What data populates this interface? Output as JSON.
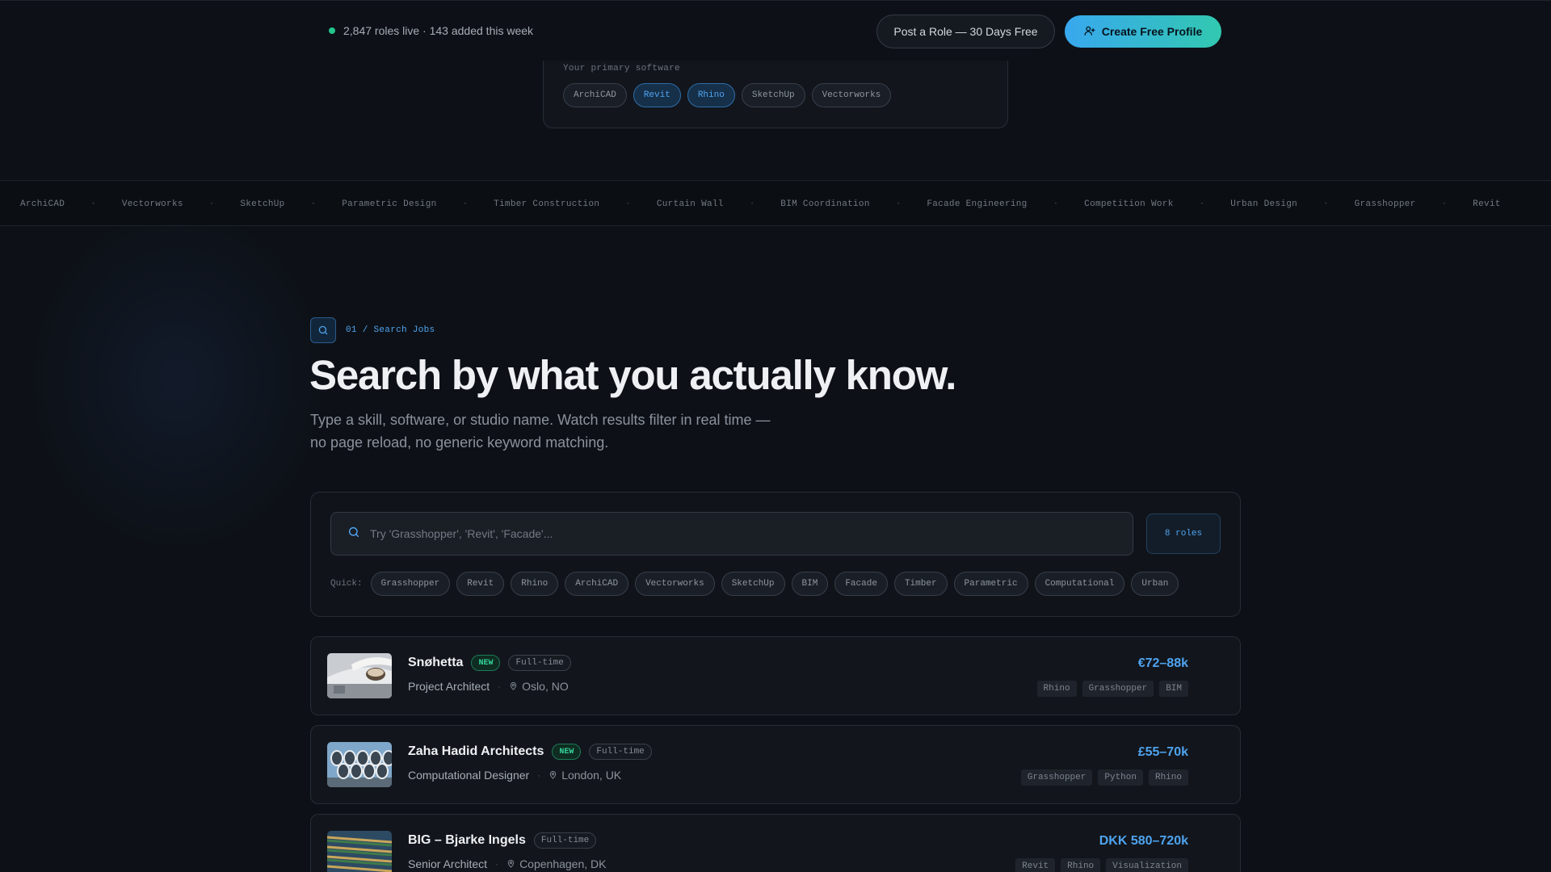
{
  "topbar": {
    "status": "2,847 roles live · 143 added this week",
    "post_role_label": "Post a Role — 30 Days Free",
    "create_profile_label": "Create Free Profile"
  },
  "software_picker": {
    "label": "Your primary software",
    "options": [
      {
        "label": "ArchiCAD",
        "selected": false
      },
      {
        "label": "Revit",
        "selected": true
      },
      {
        "label": "Rhino",
        "selected": true
      },
      {
        "label": "SketchUp",
        "selected": false
      },
      {
        "label": "Vectorworks",
        "selected": false
      }
    ]
  },
  "ticker": [
    "ArchiCAD",
    "Vectorworks",
    "SketchUp",
    "Parametric Design",
    "Timber Construction",
    "Curtain Wall",
    "BIM Coordination",
    "Facade Engineering",
    "Competition Work",
    "Urban Design",
    "Grasshopper",
    "Revit"
  ],
  "ticker_separator": "·",
  "section": {
    "eyebrow": "01 / Search Jobs",
    "title": "Search by what you actually know.",
    "subtitle_line1": "Type a skill, software, or studio name. Watch results filter in real time —",
    "subtitle_line2": "no page reload, no generic keyword matching."
  },
  "search": {
    "placeholder": "Try 'Grasshopper', 'Revit', 'Facade'...",
    "value": "",
    "count_label": "8 roles",
    "quick_label": "Quick:",
    "quick_filters": [
      "Grasshopper",
      "Revit",
      "Rhino",
      "ArchiCAD",
      "Vectorworks",
      "SketchUp",
      "BIM",
      "Facade",
      "Timber",
      "Parametric",
      "Computational",
      "Urban"
    ]
  },
  "jobs": [
    {
      "studio": "Snøhetta",
      "is_new": true,
      "new_label": "NEW",
      "type": "Full-time",
      "role": "Project Architect",
      "location": "Oslo, NO",
      "salary": "€72–88k",
      "skills": [
        "Rhino",
        "Grasshopper",
        "BIM"
      ]
    },
    {
      "studio": "Zaha Hadid Architects",
      "is_new": true,
      "new_label": "NEW",
      "type": "Full-time",
      "role": "Computational Designer",
      "location": "London, UK",
      "salary": "£55–70k",
      "skills": [
        "Grasshopper",
        "Python",
        "Rhino"
      ]
    },
    {
      "studio": "BIG – Bjarke Ingels",
      "is_new": false,
      "new_label": "",
      "type": "Full-time",
      "role": "Senior Architect",
      "location": "Copenhagen, DK",
      "salary": "DKK 580–720k",
      "skills": [
        "Revit",
        "Rhino",
        "Visualization"
      ]
    }
  ],
  "colors": {
    "background": "#0d1117",
    "accent_blue": "#4fa3ef",
    "accent_green": "#22c58b",
    "gradient_start": "#38a8ef",
    "gradient_end": "#32c8b0"
  }
}
